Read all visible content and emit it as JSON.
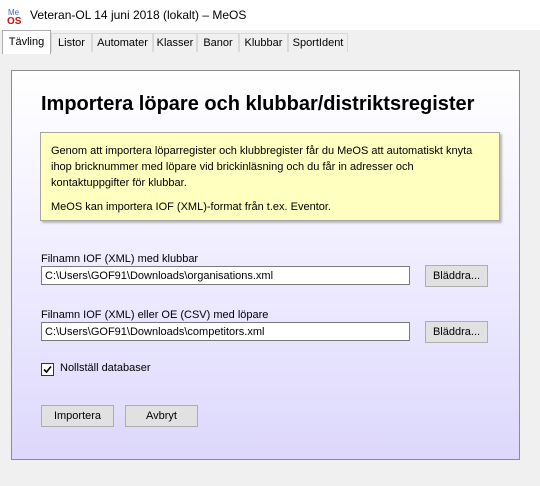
{
  "window": {
    "title": "Veteran-OL 14 juni 2018 (lokalt) – MeOS",
    "icon_text_top": "Me",
    "icon_text_bottom": "OS"
  },
  "tabs": [
    {
      "label": "Tävling",
      "active": true
    },
    {
      "label": "Listor"
    },
    {
      "label": "Automater"
    },
    {
      "label": "Klasser"
    },
    {
      "label": "Banor"
    },
    {
      "label": "Klubbar"
    },
    {
      "label": "SportIdent"
    }
  ],
  "page": {
    "heading": "Importera löpare och klubbar/distriktsregister",
    "info_paragraph_1": "Genom att importera löparregister och klubbregister får du MeOS att automatiskt knyta ihop bricknummer med löpare vid brickinläsning och du får in adresser och kontaktuppgifter för klubbar.",
    "info_paragraph_2": "MeOS kan importera IOF (XML)-format från t.ex. Eventor.",
    "clubs_label": "Filnamn IOF (XML) med klubbar",
    "clubs_path": "C:\\Users\\GOF91\\Downloads\\organisations.xml",
    "runners_label": "Filnamn IOF (XML) eller OE (CSV) med löpare",
    "runners_path": "C:\\Users\\GOF91\\Downloads\\competitors.xml",
    "browse_label": "Bläddra...",
    "reset_db_label": "Nollställ databaser",
    "reset_db_checked": true,
    "import_label": "Importera",
    "cancel_label": "Avbryt"
  },
  "colors": {
    "info_bg": "#ffffc0",
    "icon_red": "#cc1111",
    "icon_blue": "#3a67c9"
  }
}
